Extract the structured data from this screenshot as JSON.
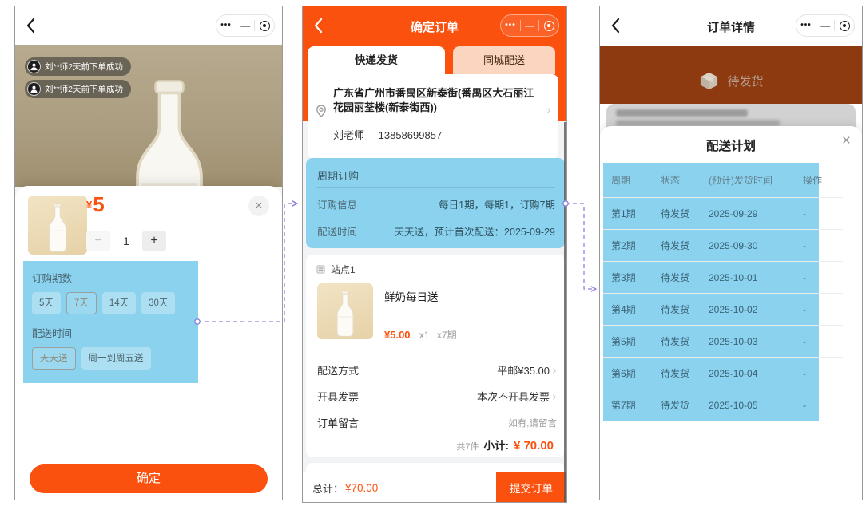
{
  "icons": {
    "more": "•••",
    "minimize": "—",
    "close": "×",
    "chevron": "›"
  },
  "colors": {
    "orange": "#fb510f",
    "blue": "#8ad2ee",
    "peach": "#fcd5c0",
    "purple": "#8d82de"
  },
  "left": {
    "toasts": [
      "刘**师2天前下单成功",
      "刘**师2天前下单成功"
    ],
    "popup": {
      "currency": "¥",
      "price": "5",
      "minus": "−",
      "qty": "1",
      "plus": "+",
      "period_label": "订购期数",
      "periods": [
        {
          "label": "5天",
          "selected": false
        },
        {
          "label": "7天",
          "selected": true
        },
        {
          "label": "14天",
          "selected": false
        },
        {
          "label": "30天",
          "selected": false
        }
      ],
      "delivery_label": "配送时间",
      "deliveries": [
        {
          "label": "天天送",
          "selected": true
        },
        {
          "label": "周一到周五送",
          "selected": false
        }
      ],
      "confirm": "确定"
    }
  },
  "middle": {
    "title": "确定订单",
    "tabs": [
      {
        "label": "快递发货",
        "active": true
      },
      {
        "label": "同城配送",
        "active": false
      }
    ],
    "address": {
      "text": "广东省广州市番禺区新泰街(番禺区大石丽江花园丽荃楼(新泰街西))",
      "name": "刘老师",
      "phone": "13858699857"
    },
    "subscription": {
      "title": "周期订购",
      "rows": [
        {
          "label": "订购信息",
          "value": "每日1期，每期1，订购7期"
        },
        {
          "label": "配送时间",
          "value": "天天送，预计首次配送：2025-09-29"
        }
      ]
    },
    "store": {
      "name": "站点1",
      "product": {
        "name": "鲜奶每日送",
        "price": "¥5.00",
        "qty": "x1",
        "periods": "x7期"
      }
    },
    "options": [
      {
        "label": "配送方式",
        "value": "平邮¥35.00"
      },
      {
        "label": "开具发票",
        "value": "本次不开具发票"
      },
      {
        "label": "订单留言",
        "value": "如有,请留言"
      }
    ],
    "summary": {
      "count": "共7件",
      "label": "小计:",
      "amount": "¥ 70.00"
    },
    "footer": {
      "label": "总计：",
      "amount": "¥70.00",
      "submit": "提交订单"
    }
  },
  "right": {
    "title": "订单详情",
    "status": "待发货",
    "modal": {
      "title": "配送计划",
      "table": {
        "headers": [
          "周期",
          "状态",
          "(预计)发货时间",
          "操作"
        ],
        "rows": [
          [
            "第1期",
            "待发货",
            "2025-09-29",
            "-"
          ],
          [
            "第2期",
            "待发货",
            "2025-09-30",
            "-"
          ],
          [
            "第3期",
            "待发货",
            "2025-10-01",
            "-"
          ],
          [
            "第4期",
            "待发货",
            "2025-10-02",
            "-"
          ],
          [
            "第5期",
            "待发货",
            "2025-10-03",
            "-"
          ],
          [
            "第6期",
            "待发货",
            "2025-10-04",
            "-"
          ],
          [
            "第7期",
            "待发货",
            "2025-10-05",
            "-"
          ]
        ]
      }
    }
  }
}
